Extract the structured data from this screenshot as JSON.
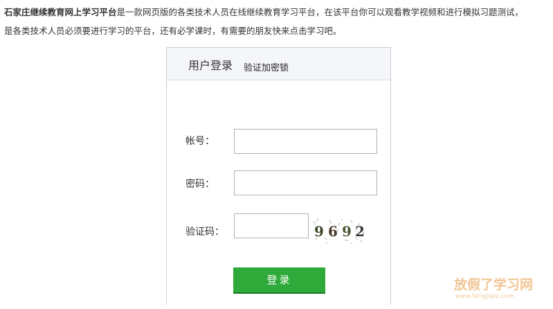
{
  "intro": {
    "bold_name": "石家庄继续教育网上学习平台",
    "line1_rest": "是一款网页版的各类技术人员在线继续教育学习平台，在该平台你可以观看教学视频和进行模拟习题测试，",
    "line2": "是各类技术人员必须要进行学习的平台，还有必学课时，有需要的朋友快来点击学习吧。"
  },
  "login": {
    "title": "用户登录",
    "subtitle": "验证加密锁",
    "fields": {
      "account_label": "帐号：",
      "account_value": "",
      "password_label": "密码：",
      "password_value": "",
      "captcha_label": "验证码：",
      "captcha_value": ""
    },
    "captcha_digits": [
      "9",
      "6",
      "9",
      "2"
    ],
    "submit_label": "登录"
  },
  "watermark": {
    "text": "放假了学习网",
    "url": "www.fangjiale.com"
  },
  "colors": {
    "button_green": "#2faa3a",
    "header_bg": "#f4f6fa",
    "border": "#cccccc"
  }
}
